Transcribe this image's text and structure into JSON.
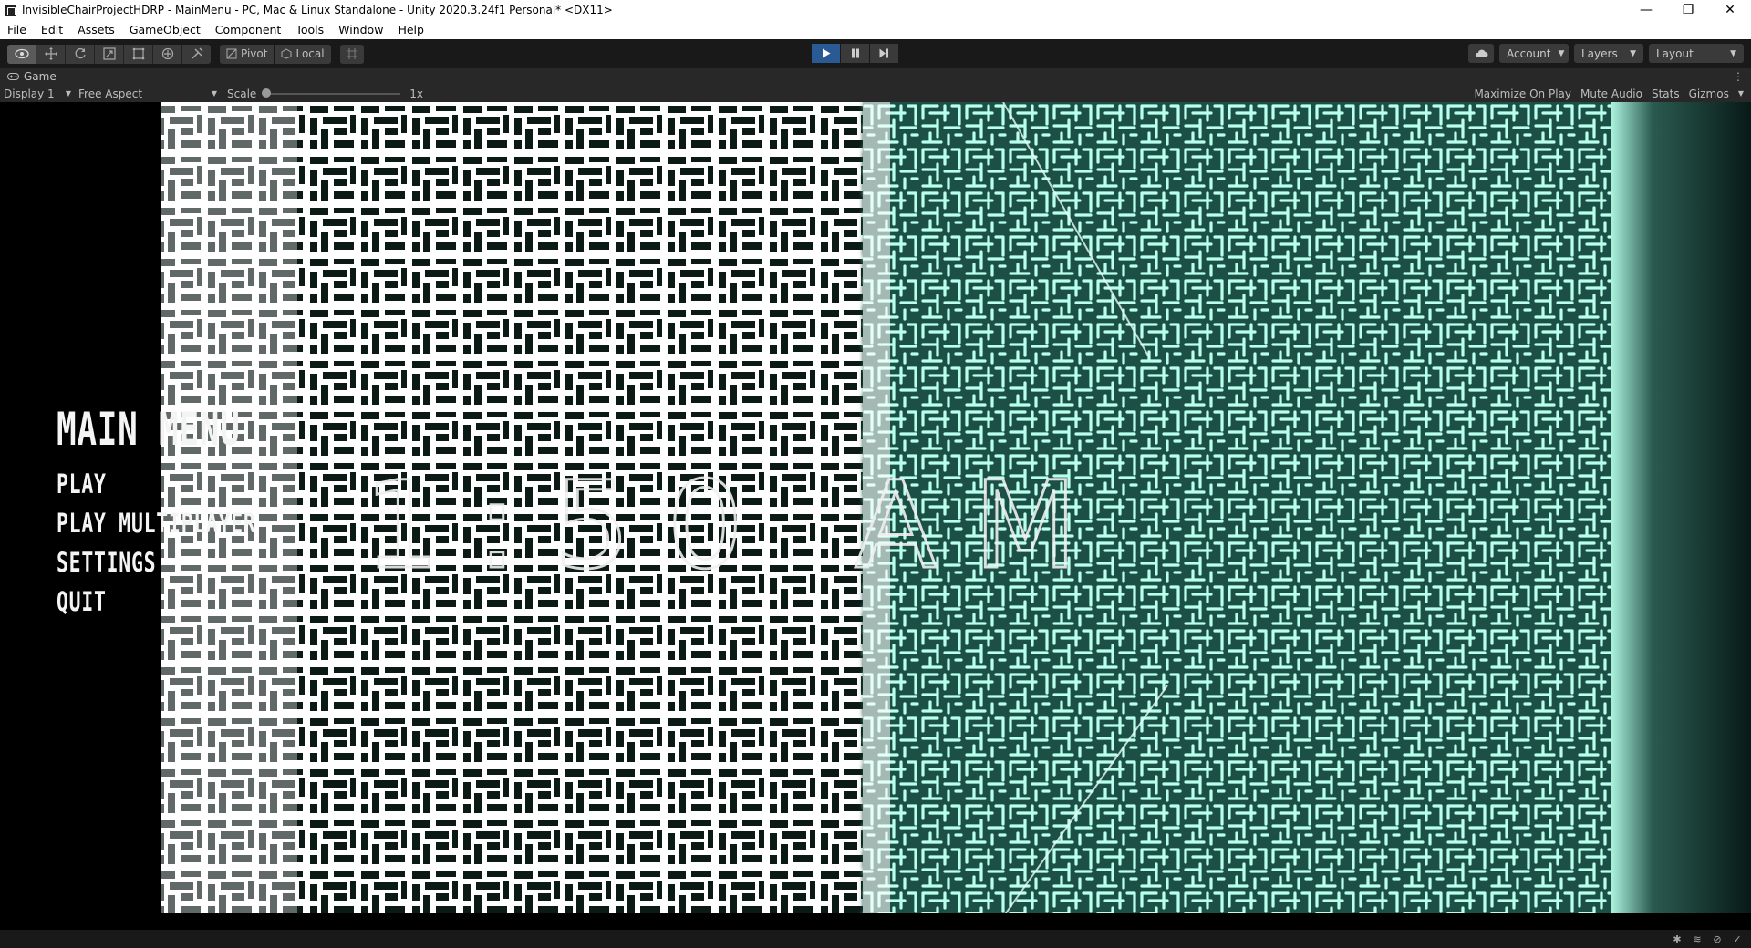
{
  "window": {
    "title": "InvisibleChairProjectHDRP - MainMenu - PC, Mac & Linux Standalone - Unity 2020.3.24f1 Personal* <DX11>",
    "controls": [
      "—",
      "❐",
      "✕"
    ]
  },
  "menubar": {
    "items": [
      "File",
      "Edit",
      "Assets",
      "GameObject",
      "Component",
      "Tools",
      "Window",
      "Help"
    ]
  },
  "toolbar": {
    "pivot_label": "Pivot",
    "local_label": "Local",
    "account_label": "Account",
    "layers_label": "Layers",
    "layout_label": "Layout"
  },
  "tab": {
    "label": "Game"
  },
  "gamebar": {
    "display": "Display 1",
    "aspect": "Free Aspect",
    "scale_label": "Scale",
    "scale_value": "1x",
    "maximize": "Maximize On Play",
    "mute": "Mute Audio",
    "stats": "Stats",
    "gizmos": "Gizmos"
  },
  "game": {
    "title": "MAIN MENU",
    "options": [
      "PLAY",
      "PLAY MULTIPLAYER",
      "SETTINGS",
      "QUIT"
    ],
    "clock": "1:50 AM"
  },
  "colors": {
    "accent_play": "#2a5a94",
    "maze_teal": "#7fffe0"
  }
}
